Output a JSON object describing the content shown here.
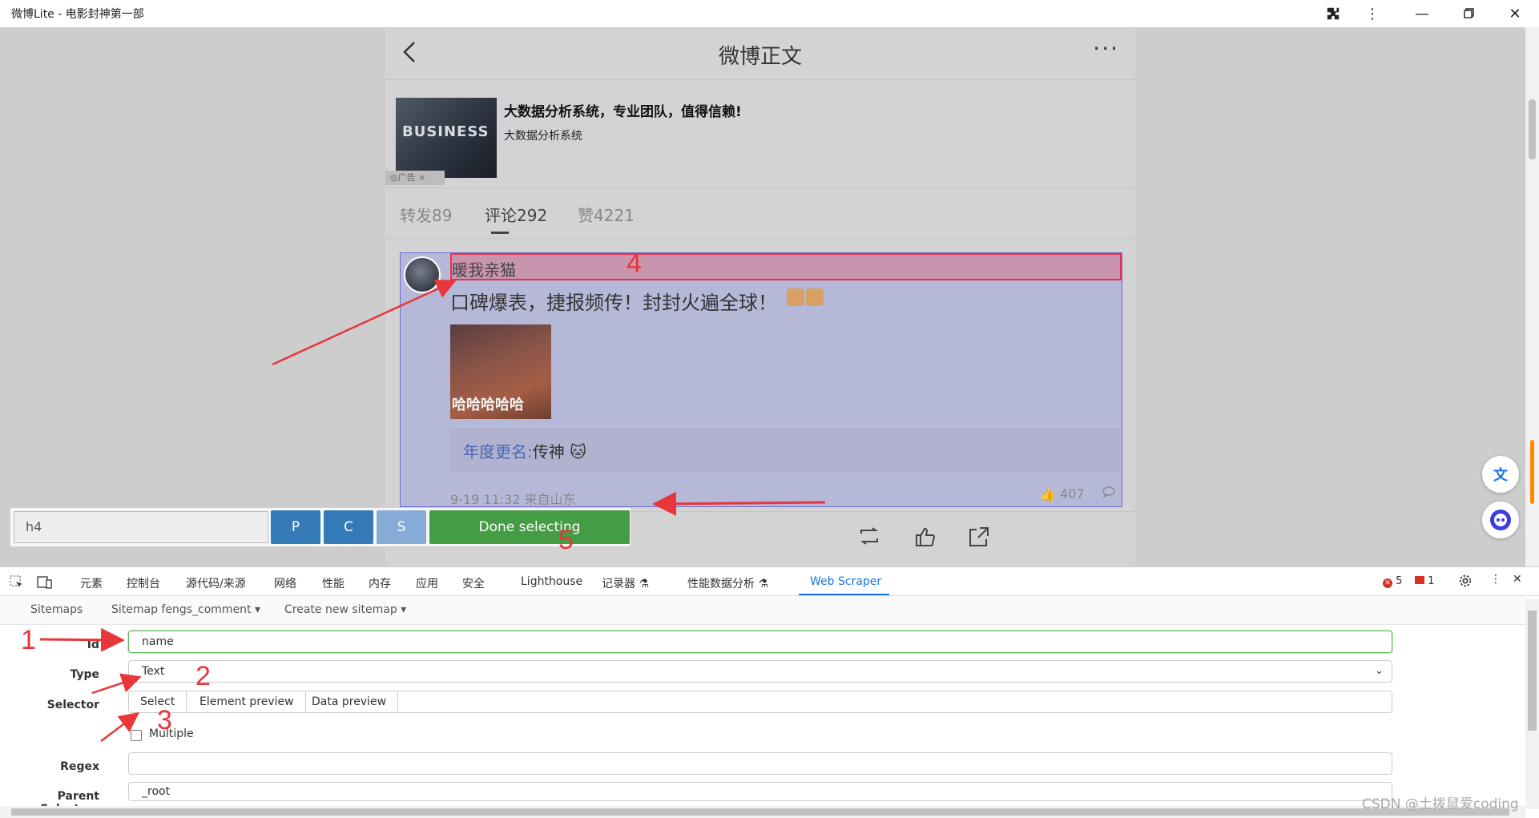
{
  "window": {
    "title": "微博Lite - 电影封神第一部",
    "controls": [
      "extension-icon",
      "menu-dots-icon",
      "minimize-icon",
      "maximize-icon",
      "close-icon"
    ]
  },
  "page": {
    "title": "微博正文",
    "ad": {
      "image_text": "BUSINESS",
      "tag": "◎广告 ×",
      "title": "大数据分析系统，专业团队，值得信赖!",
      "subtitle": "大数据分析系统"
    },
    "tabs": [
      {
        "label": "转发89"
      },
      {
        "label": "评论292"
      },
      {
        "label": "赞4221"
      }
    ],
    "comment": {
      "author": "暖我亲猫",
      "text": "口碑爆表，捷报频传！封封火遍全球！",
      "image_caption": "哈哈哈哈哈",
      "quote_prefix": "年度更名:",
      "quote_suffix": "传神",
      "meta": "9-19 11:32 来自山东",
      "likes": "407"
    }
  },
  "selector_toolbar": {
    "input_value": "h4",
    "btn_p": "P",
    "btn_c": "C",
    "btn_s": "S",
    "done": "Done selecting",
    "colors": {
      "p": "#337ab7",
      "c": "#337ab7",
      "s": "#86abd6",
      "done": "#449d44"
    }
  },
  "devtools": {
    "tabs": [
      "元素",
      "控制台",
      "源代码/来源",
      "网络",
      "性能",
      "内存",
      "应用",
      "安全",
      "Lighthouse",
      "记录器 ⚗",
      "性能数据分析 ⚗",
      "Web Scraper"
    ],
    "errors": "5",
    "issues": "1",
    "webscraper_nav": {
      "sitemaps": "Sitemaps",
      "sitemap": "Sitemap fengs_comment ▾",
      "create": "Create new sitemap ▾"
    },
    "form": {
      "id_label": "Id",
      "id_value": "name",
      "type_label": "Type",
      "type_value": "Text",
      "selector_label": "Selector",
      "select_btn": "Select",
      "element_preview_btn": "Element preview",
      "data_preview_btn": "Data preview",
      "multiple_label": "Multiple",
      "regex_label": "Regex",
      "regex_value": "",
      "parent_label": "Parent Selectors",
      "parent_value": "_root"
    }
  },
  "annotations": [
    "1",
    "2",
    "3",
    "4",
    "5"
  ],
  "watermark": "CSDN @土拨鼠爱coding"
}
